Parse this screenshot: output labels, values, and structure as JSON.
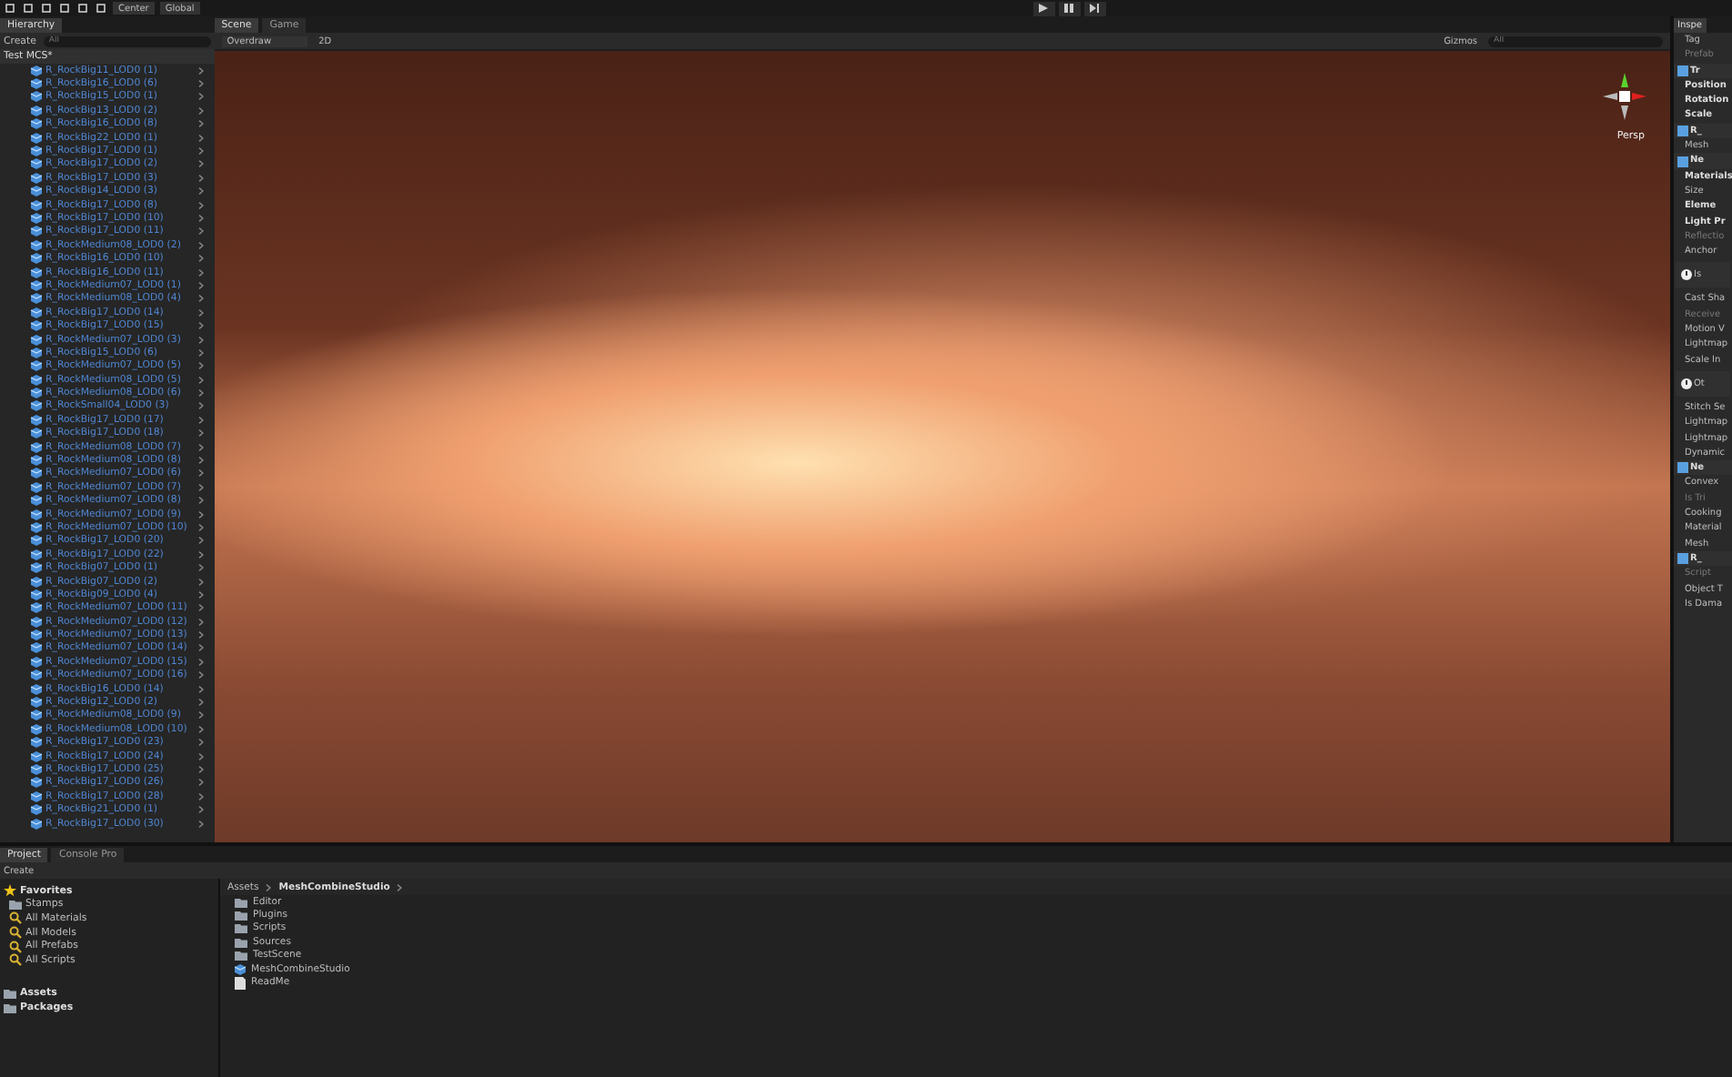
{
  "toolbar": {
    "pivot": "Center",
    "space": "Global"
  },
  "hierarchy": {
    "tab": "Hierarchy",
    "create": "Create",
    "placeholder": "All",
    "root": "Test MCS*",
    "items": [
      "R_RockBig11_LOD0 (1)",
      "R_RockBig16_LOD0 (6)",
      "R_RockBig15_LOD0 (1)",
      "R_RockBig13_LOD0 (2)",
      "R_RockBig16_LOD0 (8)",
      "R_RockBig22_LOD0 (1)",
      "R_RockBig17_LOD0 (1)",
      "R_RockBig17_LOD0 (2)",
      "R_RockBig17_LOD0 (3)",
      "R_RockBig14_LOD0 (3)",
      "R_RockBig17_LOD0 (8)",
      "R_RockBig17_LOD0 (10)",
      "R_RockBig17_LOD0 (11)",
      "R_RockMedium08_LOD0 (2)",
      "R_RockBig16_LOD0 (10)",
      "R_RockBig16_LOD0 (11)",
      "R_RockMedium07_LOD0 (1)",
      "R_RockMedium08_LOD0 (4)",
      "R_RockBig17_LOD0 (14)",
      "R_RockBig17_LOD0 (15)",
      "R_RockMedium07_LOD0 (3)",
      "R_RockBig15_LOD0 (6)",
      "R_RockMedium07_LOD0 (5)",
      "R_RockMedium08_LOD0 (5)",
      "R_RockMedium08_LOD0 (6)",
      "R_RockSmall04_LOD0 (3)",
      "R_RockBig17_LOD0 (17)",
      "R_RockBig17_LOD0 (18)",
      "R_RockMedium08_LOD0 (7)",
      "R_RockMedium08_LOD0 (8)",
      "R_RockMedium07_LOD0 (6)",
      "R_RockMedium07_LOD0 (7)",
      "R_RockMedium07_LOD0 (8)",
      "R_RockMedium07_LOD0 (9)",
      "R_RockMedium07_LOD0 (10)",
      "R_RockBig17_LOD0 (20)",
      "R_RockBig17_LOD0 (22)",
      "R_RockBig07_LOD0 (1)",
      "R_RockBig07_LOD0 (2)",
      "R_RockBig09_LOD0 (4)",
      "R_RockMedium07_LOD0 (11)",
      "R_RockMedium07_LOD0 (12)",
      "R_RockMedium07_LOD0 (13)",
      "R_RockMedium07_LOD0 (14)",
      "R_RockMedium07_LOD0 (15)",
      "R_RockMedium07_LOD0 (16)",
      "R_RockBig16_LOD0 (14)",
      "R_RockBig12_LOD0 (2)",
      "R_RockMedium08_LOD0 (9)",
      "R_RockMedium08_LOD0 (10)",
      "R_RockBig17_LOD0 (23)",
      "R_RockBig17_LOD0 (24)",
      "R_RockBig17_LOD0 (25)",
      "R_RockBig17_LOD0 (26)",
      "R_RockBig17_LOD0 (28)",
      "R_RockBig21_LOD0 (1)",
      "R_RockBig17_LOD0 (30)"
    ]
  },
  "scene": {
    "tabs": [
      {
        "label": "Scene",
        "selected": true
      },
      {
        "label": "Game",
        "selected": false
      }
    ],
    "draw_mode": "Overdraw",
    "mode_2d": "2D",
    "gizmos": "Gizmos",
    "placeholder": "All",
    "projection": "Persp"
  },
  "inspector": {
    "tab": "Inspe",
    "rows": [
      {
        "kind": "label",
        "text": "Tag"
      },
      {
        "kind": "dim",
        "text": "Prefab"
      },
      {
        "kind": "header",
        "text": "Tr"
      },
      {
        "kind": "bold",
        "text": "Position"
      },
      {
        "kind": "bold",
        "text": "Rotation"
      },
      {
        "kind": "bold",
        "text": "Scale"
      },
      {
        "kind": "header",
        "text": "R_"
      },
      {
        "kind": "label",
        "text": "Mesh"
      },
      {
        "kind": "header",
        "text": "Ne"
      },
      {
        "kind": "bold",
        "text": "Materials"
      },
      {
        "kind": "label",
        "text": "Size"
      },
      {
        "kind": "bold",
        "text": "Eleme"
      },
      {
        "kind": "bold",
        "text": "Light Pr"
      },
      {
        "kind": "dim",
        "text": "Reflectio"
      },
      {
        "kind": "label",
        "text": "Anchor"
      },
      {
        "kind": "info",
        "text": "Is"
      },
      {
        "kind": "label",
        "text": "Cast Sha"
      },
      {
        "kind": "dim",
        "text": "Receive"
      },
      {
        "kind": "label",
        "text": "Motion V"
      },
      {
        "kind": "label",
        "text": "Lightmap"
      },
      {
        "kind": "label",
        "text": "Scale In"
      },
      {
        "kind": "info",
        "text": "Ot"
      },
      {
        "kind": "label",
        "text": "Stitch Se"
      },
      {
        "kind": "label",
        "text": "Lightmap"
      },
      {
        "kind": "label",
        "text": "Lightmap"
      },
      {
        "kind": "label",
        "text": "Dynamic"
      },
      {
        "kind": "header",
        "text": "Ne"
      },
      {
        "kind": "label",
        "text": "Convex"
      },
      {
        "kind": "dim",
        "text": "Is Tri"
      },
      {
        "kind": "label",
        "text": "Cooking"
      },
      {
        "kind": "label",
        "text": "Material"
      },
      {
        "kind": "label",
        "text": "Mesh"
      },
      {
        "kind": "header",
        "text": "R_"
      },
      {
        "kind": "dim",
        "text": "Script"
      },
      {
        "kind": "label",
        "text": "Object T"
      },
      {
        "kind": "label",
        "text": "Is Dama"
      }
    ]
  },
  "project": {
    "tabs": [
      {
        "label": "Project",
        "selected": true
      },
      {
        "label": "Console Pro",
        "selected": false
      }
    ],
    "create": "Create",
    "favorites": {
      "label": "Favorites",
      "children": [
        {
          "kind": "folder",
          "label": "Stamps"
        },
        {
          "kind": "search",
          "label": "All Materials"
        },
        {
          "kind": "search",
          "label": "All Models"
        },
        {
          "kind": "search",
          "label": "All Prefabs"
        },
        {
          "kind": "search",
          "label": "All Scripts"
        }
      ]
    },
    "roots": [
      "Assets",
      "Packages"
    ],
    "breadcrumb": [
      "Assets",
      "MeshCombineStudio"
    ],
    "files": [
      {
        "kind": "folder",
        "label": "Editor"
      },
      {
        "kind": "folder",
        "label": "Plugins"
      },
      {
        "kind": "folder",
        "label": "Scripts"
      },
      {
        "kind": "folder",
        "label": "Sources"
      },
      {
        "kind": "folder",
        "label": "TestScene"
      },
      {
        "kind": "prefab",
        "label": "MeshCombineStudio"
      },
      {
        "kind": "doc",
        "label": "ReadMe"
      }
    ]
  }
}
